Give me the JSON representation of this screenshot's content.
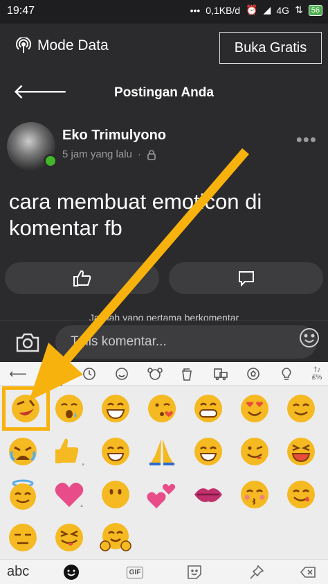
{
  "status_bar": {
    "time": "19:47",
    "network_speed": "0,1KB/d",
    "network_type": "4G",
    "battery": "56"
  },
  "data_bar": {
    "mode_label": "Mode Data",
    "buka_gratis_label": "Buka Gratis"
  },
  "header": {
    "title": "Postingan Anda"
  },
  "post": {
    "author_name": "Eko Trimulyono",
    "time_ago": "5 jam yang lalu",
    "separator": "·",
    "more_label": "•••",
    "text": "cara membuat emoticon di komentar fb",
    "first_comment_hint": "Jadilah yang pertama berkomentar"
  },
  "comment_bar": {
    "placeholder": "Tulis komentar..."
  },
  "keyboard": {
    "tabs": [
      "back-arrow-icon",
      "sticker-icon",
      "clock-icon",
      "smiley-icon",
      "animal-icon",
      "cup-icon",
      "vehicle-icon",
      "ball-icon",
      "bulb-icon",
      "symbols-icon"
    ],
    "symbols_label": "†♪\n₤%",
    "emoji_rows": [
      [
        "😝",
        "😪",
        "😁",
        "😘",
        "😁",
        "😍",
        "😊"
      ],
      [
        "😭",
        "👍",
        "😁",
        "🙏",
        "😁",
        "😜",
        "😆"
      ],
      [
        "😇",
        "❤",
        "😶",
        "💕",
        "💋",
        "😚",
        "😊"
      ],
      [
        "😑",
        "😝",
        "🤗"
      ]
    ],
    "bottom": {
      "abc_label": "abc",
      "gif_label": "GIF"
    }
  },
  "colors": {
    "highlight": "#f7b20d",
    "online": "#42b72a",
    "background": "#2b2b2d"
  }
}
